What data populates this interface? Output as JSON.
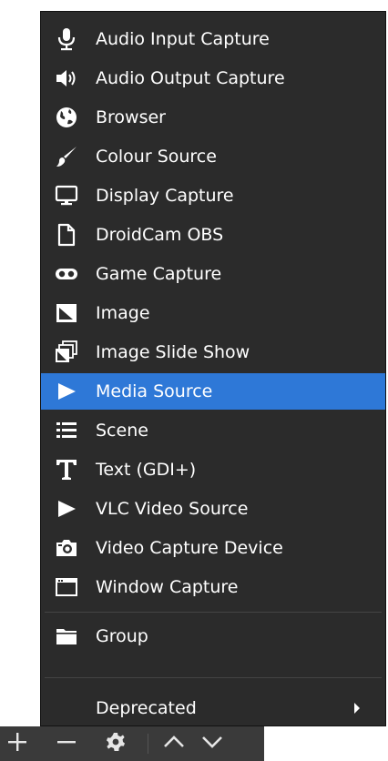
{
  "menu": {
    "items": [
      {
        "label": "Audio Input Capture",
        "icon": "microphone-icon"
      },
      {
        "label": "Audio Output Capture",
        "icon": "speaker-icon"
      },
      {
        "label": "Browser",
        "icon": "globe-icon"
      },
      {
        "label": "Colour Source",
        "icon": "paintbrush-icon"
      },
      {
        "label": "Display Capture",
        "icon": "monitor-icon"
      },
      {
        "label": "DroidCam OBS",
        "icon": "file-icon"
      },
      {
        "label": "Game Capture",
        "icon": "gamepad-icon"
      },
      {
        "label": "Image",
        "icon": "image-icon"
      },
      {
        "label": "Image Slide Show",
        "icon": "image-stack-icon"
      },
      {
        "label": "Media Source",
        "icon": "play-icon",
        "selected": true
      },
      {
        "label": "Scene",
        "icon": "list-icon"
      },
      {
        "label": "Text (GDI+)",
        "icon": "text-icon"
      },
      {
        "label": "VLC Video Source",
        "icon": "play-icon"
      },
      {
        "label": "Video Capture Device",
        "icon": "camera-icon"
      },
      {
        "label": "Window Capture",
        "icon": "window-icon"
      }
    ],
    "group_label": "Group",
    "group_icon": "folder-icon",
    "deprecated_label": "Deprecated",
    "deprecated_icon": "chevron-right-icon"
  },
  "toolbar": {
    "buttons": [
      "plus-icon",
      "minus-icon",
      "gear-icon",
      "chevron-up-icon",
      "chevron-down-icon"
    ]
  },
  "colors": {
    "menu_bg": "#2b2b2b",
    "selected_bg": "#2e78d7",
    "text": "#ffffff",
    "toolbar_bg": "#3a3a3a"
  }
}
